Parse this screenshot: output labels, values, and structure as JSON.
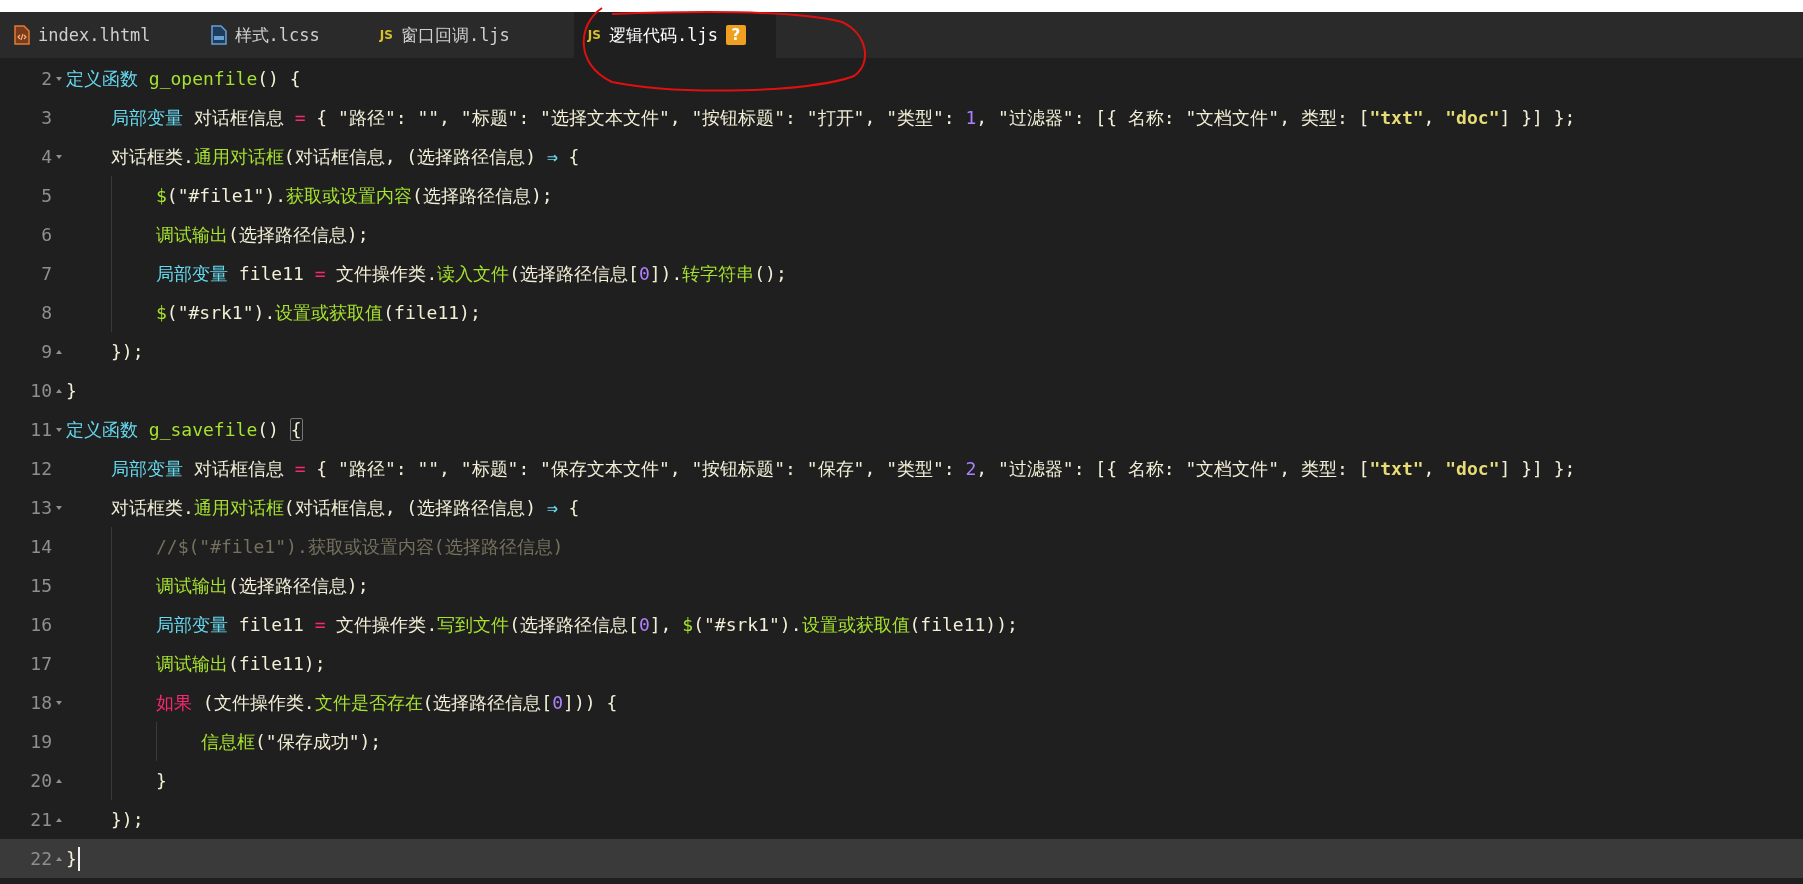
{
  "tabs": [
    {
      "label": "index.lhtml",
      "kind": "html",
      "selected": false
    },
    {
      "label": "样式.lcss",
      "kind": "css",
      "selected": false
    },
    {
      "label": "窗口回调.ljs",
      "kind": "js",
      "icon_text": "JS",
      "selected": false
    },
    {
      "label": "逻辑代码.ljs",
      "kind": "js",
      "icon_text": "JS",
      "selected": true,
      "badge": "?"
    }
  ],
  "lines": [
    {
      "number": "2",
      "fold_start": true,
      "tokens": [
        {
          "kind": "kw",
          "text": "定义函数 "
        },
        {
          "kind": "func",
          "text": "g_openfile"
        },
        {
          "kind": "plain",
          "text": "() {"
        }
      ],
      "children": [
        {
          "number": "3",
          "tokens": [
            {
              "kind": "kw",
              "text": "局部变量"
            },
            {
              "kind": "plain",
              "text": " 对话框信息 "
            },
            {
              "kind": "op",
              "text": "="
            },
            {
              "kind": "plain",
              "text": " { \"路径\": \"\", \"标题\": \"选择文本文件\", \"按钮标题\": \"打开\", \"类型\": "
            },
            {
              "kind": "num",
              "text": "1"
            },
            {
              "kind": "plain",
              "text": ", \"过滤器\": [{ 名称: \"文档文件\", 类型: ["
            },
            {
              "kind": "str",
              "text": "\"txt\""
            },
            {
              "kind": "plain",
              "text": ", "
            },
            {
              "kind": "str",
              "text": "\"doc\""
            },
            {
              "kind": "plain",
              "text": "] }] };"
            }
          ]
        },
        {
          "number": "4",
          "fold_start": true,
          "tokens": [
            {
              "kind": "plain",
              "text": "对话框类."
            },
            {
              "kind": "func",
              "text": "通用对话框"
            },
            {
              "kind": "plain",
              "text": "(对话框信息, (选择路径信息) "
            },
            {
              "kind": "arrow",
              "text": "⇒"
            },
            {
              "kind": "plain",
              "text": " {"
            }
          ],
          "children": [
            {
              "number": "5",
              "tokens": [
                {
                  "kind": "func",
                  "text": "$"
                },
                {
                  "kind": "plain",
                  "text": "(\"#file1\")."
                },
                {
                  "kind": "func",
                  "text": "获取或设置内容"
                },
                {
                  "kind": "plain",
                  "text": "(选择路径信息);"
                }
              ]
            },
            {
              "number": "6",
              "tokens": [
                {
                  "kind": "func",
                  "text": "调试输出"
                },
                {
                  "kind": "plain",
                  "text": "(选择路径信息);"
                }
              ]
            },
            {
              "number": "7",
              "tokens": [
                {
                  "kind": "kw",
                  "text": "局部变量"
                },
                {
                  "kind": "plain",
                  "text": " file11 "
                },
                {
                  "kind": "op",
                  "text": "="
                },
                {
                  "kind": "plain",
                  "text": " 文件操作类."
                },
                {
                  "kind": "func",
                  "text": "读入文件"
                },
                {
                  "kind": "plain",
                  "text": "(选择路径信息["
                },
                {
                  "kind": "num",
                  "text": "0"
                },
                {
                  "kind": "plain",
                  "text": "])."
                },
                {
                  "kind": "func",
                  "text": "转字符串"
                },
                {
                  "kind": "plain",
                  "text": "();"
                }
              ]
            },
            {
              "number": "8",
              "tokens": [
                {
                  "kind": "func",
                  "text": "$"
                },
                {
                  "kind": "plain",
                  "text": "(\"#srk1\")."
                },
                {
                  "kind": "func",
                  "text": "设置或获取值"
                },
                {
                  "kind": "plain",
                  "text": "(file11);"
                }
              ]
            }
          ]
        },
        {
          "number": "9",
          "fold_end": true,
          "tokens": [
            {
              "kind": "plain",
              "text": "});"
            }
          ]
        }
      ]
    },
    {
      "number": "10",
      "fold_end": true,
      "tokens": [
        {
          "kind": "plain",
          "text": "}"
        }
      ]
    },
    {
      "number": "11",
      "fold_start": true,
      "tokens": [
        {
          "kind": "kw",
          "text": "定义函数 "
        },
        {
          "kind": "func",
          "text": "g_savefile"
        },
        {
          "kind": "plain",
          "text": "() "
        },
        {
          "kind": "plain",
          "text": "{",
          "matched": true
        }
      ],
      "children": [
        {
          "number": "12",
          "tokens": [
            {
              "kind": "kw",
              "text": "局部变量"
            },
            {
              "kind": "plain",
              "text": " 对话框信息 "
            },
            {
              "kind": "op",
              "text": "="
            },
            {
              "kind": "plain",
              "text": " { \"路径\": \"\", \"标题\": \"保存文本文件\", \"按钮标题\": \"保存\", \"类型\": "
            },
            {
              "kind": "num",
              "text": "2"
            },
            {
              "kind": "plain",
              "text": ", \"过滤器\": [{ 名称: \"文档文件\", 类型: ["
            },
            {
              "kind": "str",
              "text": "\"txt\""
            },
            {
              "kind": "plain",
              "text": ", "
            },
            {
              "kind": "str",
              "text": "\"doc\""
            },
            {
              "kind": "plain",
              "text": "] }] };"
            }
          ]
        },
        {
          "number": "13",
          "fold_start": true,
          "tokens": [
            {
              "kind": "plain",
              "text": "对话框类."
            },
            {
              "kind": "func",
              "text": "通用对话框"
            },
            {
              "kind": "plain",
              "text": "(对话框信息, (选择路径信息) "
            },
            {
              "kind": "arrow",
              "text": "⇒"
            },
            {
              "kind": "plain",
              "text": " {"
            }
          ],
          "children": [
            {
              "number": "14",
              "tokens": [
                {
                  "kind": "comment",
                  "text": "//$(\"#file1\").获取或设置内容(选择路径信息)"
                }
              ]
            },
            {
              "number": "15",
              "tokens": [
                {
                  "kind": "func",
                  "text": "调试输出"
                },
                {
                  "kind": "plain",
                  "text": "(选择路径信息);"
                }
              ]
            },
            {
              "number": "16",
              "tokens": [
                {
                  "kind": "kw",
                  "text": "局部变量"
                },
                {
                  "kind": "plain",
                  "text": " file11 "
                },
                {
                  "kind": "op",
                  "text": "="
                },
                {
                  "kind": "plain",
                  "text": " 文件操作类."
                },
                {
                  "kind": "func",
                  "text": "写到文件"
                },
                {
                  "kind": "plain",
                  "text": "(选择路径信息["
                },
                {
                  "kind": "num",
                  "text": "0"
                },
                {
                  "kind": "plain",
                  "text": "], "
                },
                {
                  "kind": "func",
                  "text": "$"
                },
                {
                  "kind": "plain",
                  "text": "(\"#srk1\")."
                },
                {
                  "kind": "func",
                  "text": "设置或获取值"
                },
                {
                  "kind": "plain",
                  "text": "(file11));"
                }
              ]
            },
            {
              "number": "17",
              "tokens": [
                {
                  "kind": "func",
                  "text": "调试输出"
                },
                {
                  "kind": "plain",
                  "text": "(file11);"
                }
              ]
            },
            {
              "number": "18",
              "fold_start": true,
              "tokens": [
                {
                  "kind": "ctrl",
                  "text": "如果"
                },
                {
                  "kind": "plain",
                  "text": " (文件操作类."
                },
                {
                  "kind": "func",
                  "text": "文件是否存在"
                },
                {
                  "kind": "plain",
                  "text": "(选择路径信息["
                },
                {
                  "kind": "num",
                  "text": "0"
                },
                {
                  "kind": "plain",
                  "text": "])) {"
                }
              ],
              "children": [
                {
                  "number": "19",
                  "tokens": [
                    {
                      "kind": "func",
                      "text": "信息框"
                    },
                    {
                      "kind": "plain",
                      "text": "(\"保存成功\");"
                    }
                  ]
                }
              ]
            },
            {
              "number": "20",
              "fold_end": true,
              "tokens": [
                {
                  "kind": "plain",
                  "text": "}"
                }
              ]
            }
          ]
        },
        {
          "number": "21",
          "fold_end": true,
          "tokens": [
            {
              "kind": "plain",
              "text": "});"
            }
          ]
        }
      ]
    },
    {
      "number": "22",
      "fold_end": true,
      "current": true,
      "tokens": [
        {
          "kind": "plain",
          "text": "}"
        }
      ]
    }
  ]
}
